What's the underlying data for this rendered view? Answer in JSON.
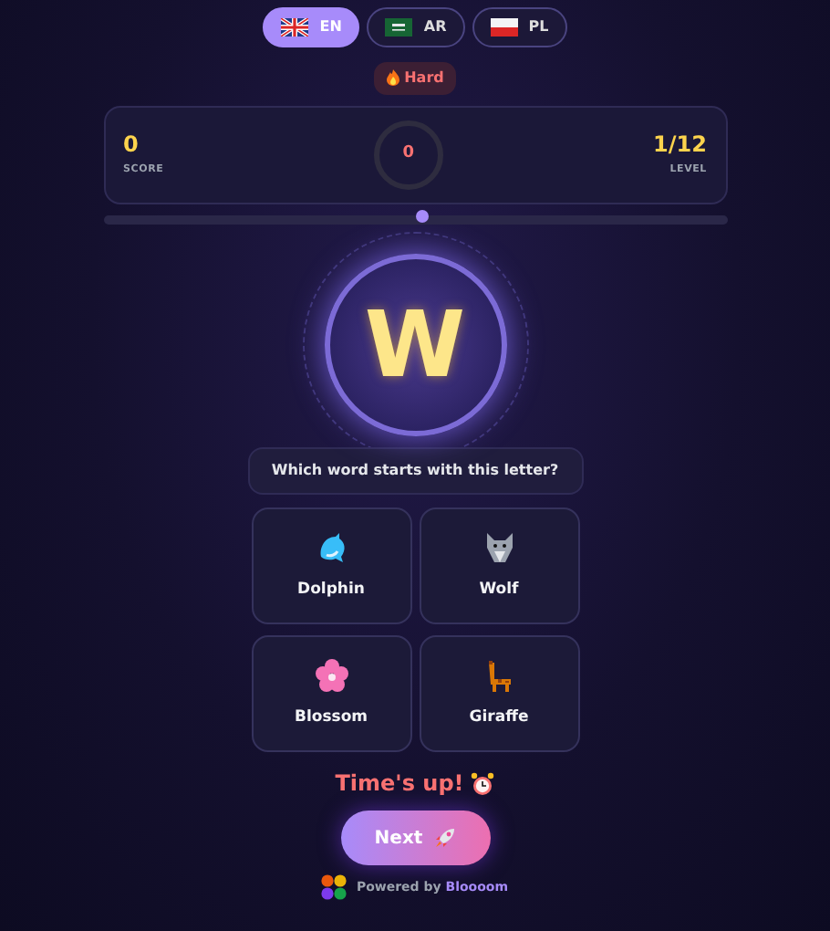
{
  "languages": [
    {
      "code": "EN",
      "selected": true
    },
    {
      "code": "AR",
      "selected": false
    },
    {
      "code": "PL",
      "selected": false
    }
  ],
  "difficulty": {
    "label": "Hard"
  },
  "stats": {
    "score": "0",
    "score_label": "SCORE",
    "timer": "0",
    "level": "1/12",
    "level_label": "LEVEL"
  },
  "progress": {
    "level": 0.51
  },
  "letter": "W",
  "question": "Which word starts with this letter?",
  "options": [
    {
      "label": "Dolphin"
    },
    {
      "label": "Wolf"
    },
    {
      "label": "Blossom"
    },
    {
      "label": "Giraffe"
    }
  ],
  "result": {
    "text": "Time's up!"
  },
  "next_button": {
    "label": "Next"
  },
  "footer": {
    "prefix": "Powered by",
    "brand": "Bloooom"
  }
}
